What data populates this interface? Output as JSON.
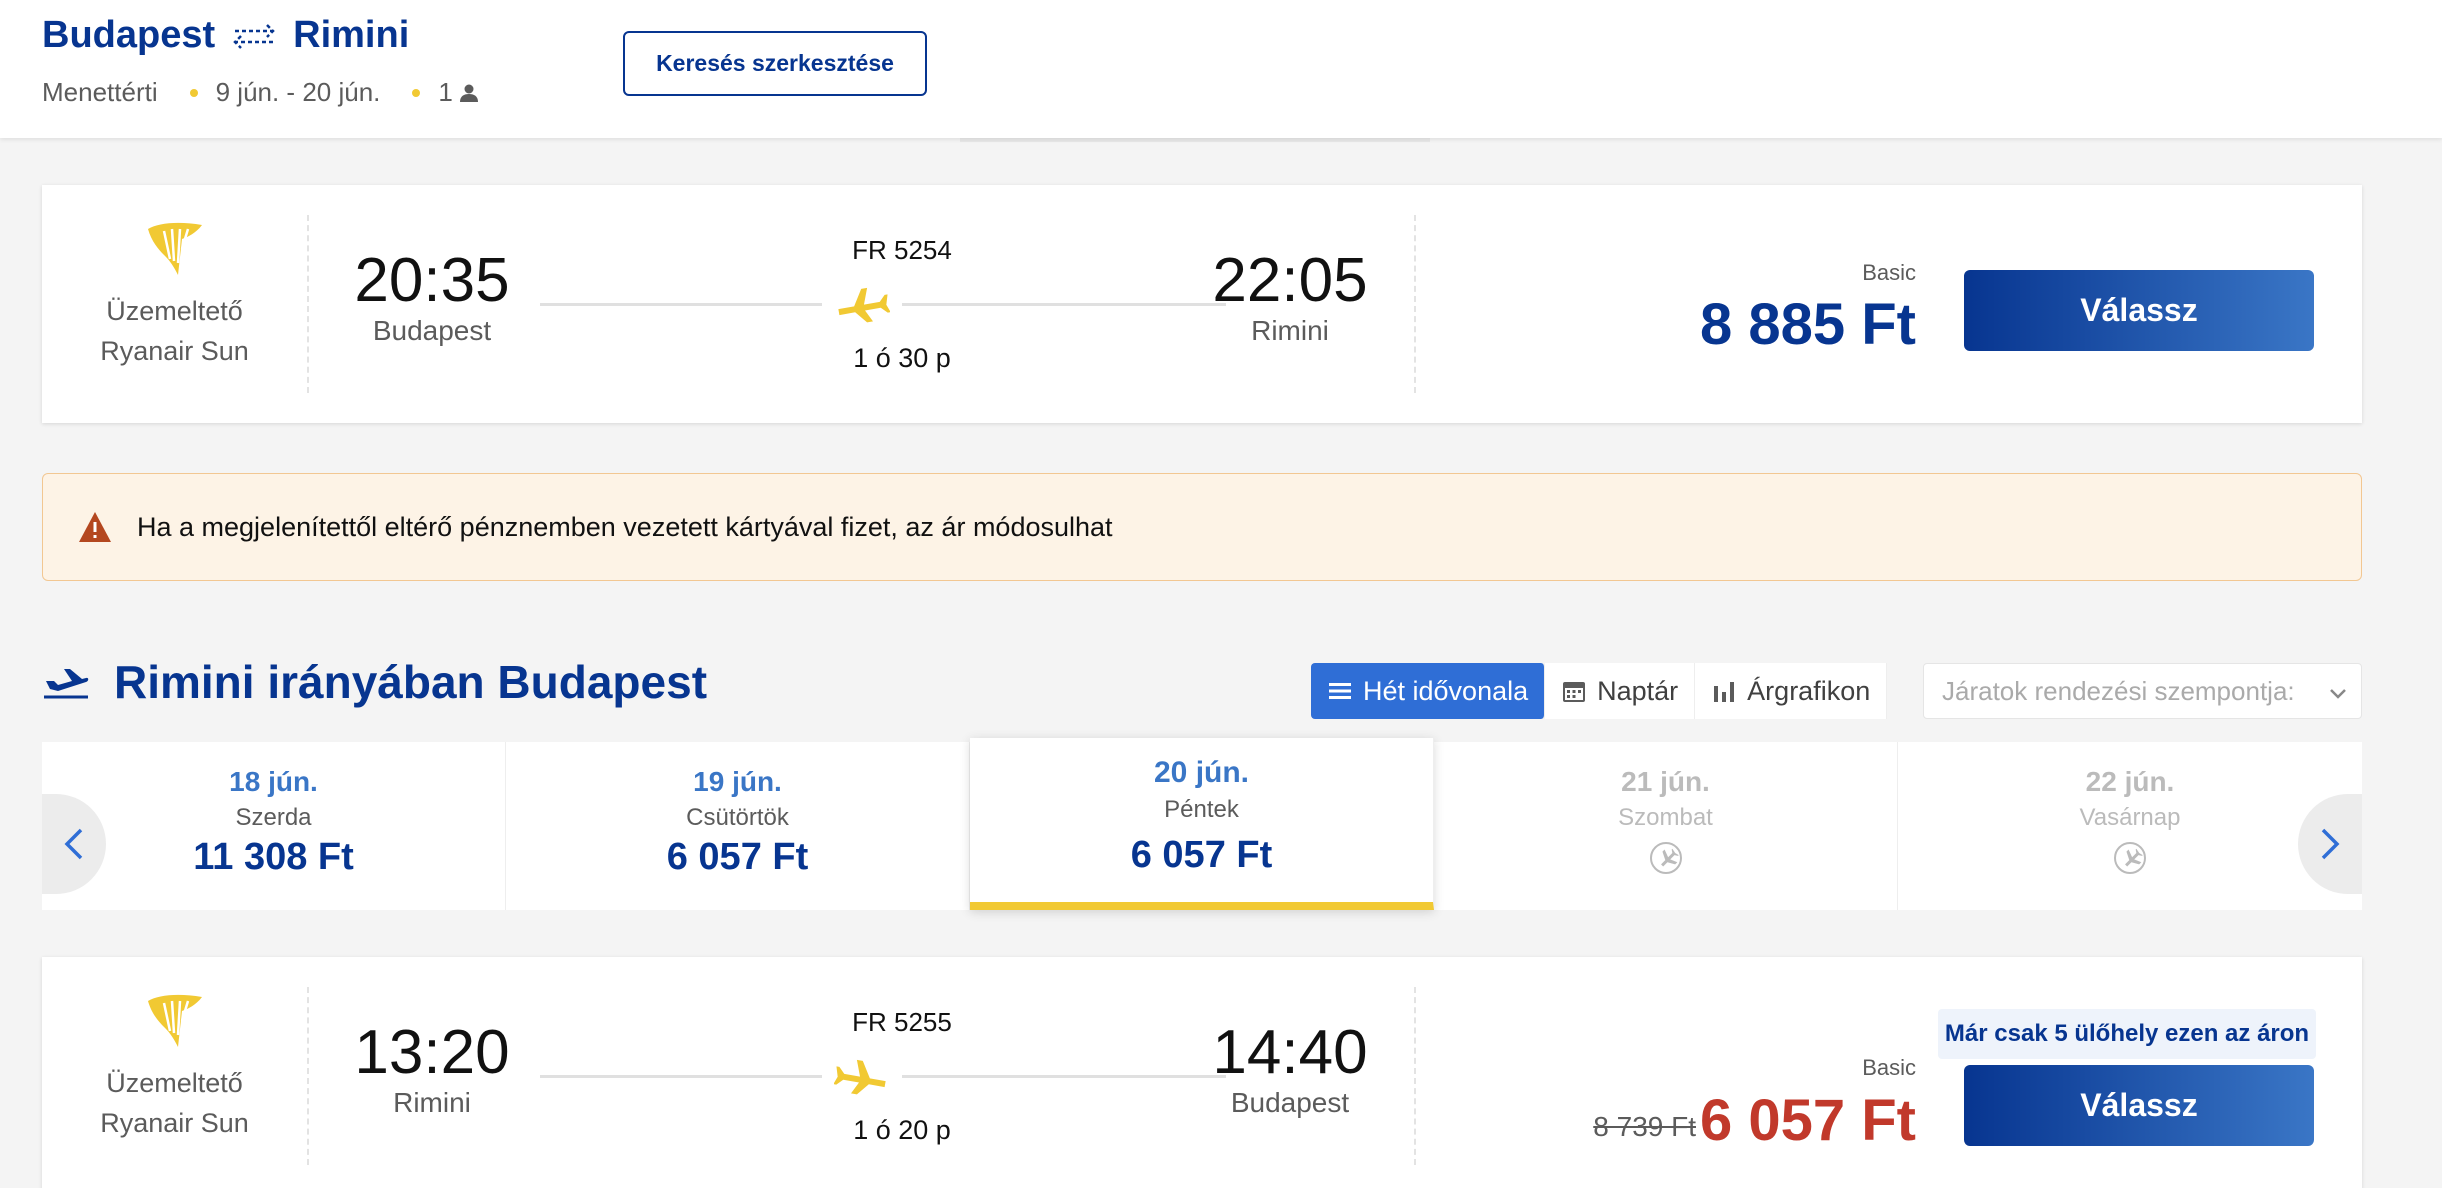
{
  "header": {
    "origin": "Budapest",
    "destination": "Rimini",
    "trip_type": "Menettérti",
    "dates": "9 jún. - 20 jún.",
    "passengers": "1",
    "edit_label": "Keresés szerkesztése"
  },
  "outbound_flight": {
    "operator_label": "Üzemeltető",
    "operator_name": "Ryanair Sun",
    "dep_time": "20:35",
    "dep_city": "Budapest",
    "flight_no": "FR 5254",
    "duration": "1 ó 30 p",
    "arr_time": "22:05",
    "arr_city": "Rimini",
    "fare_type": "Basic",
    "price": "8 885 Ft",
    "select_label": "Válassz"
  },
  "warning": {
    "text": "Ha a megjelenítettől eltérő pénznemben vezetett kártyával fizet, az ár módosulhat"
  },
  "return_section": {
    "title": "Rimini irányában Budapest",
    "tabs": [
      "Hét idővonala",
      "Naptár",
      "Árgrafikon"
    ],
    "sort_placeholder": "Járatok rendezési szempontja:"
  },
  "date_strip": [
    {
      "date": "18 jún.",
      "weekday": "Szerda",
      "price": "11 308 Ft"
    },
    {
      "date": "19 jún.",
      "weekday": "Csütörtök",
      "price": "6 057 Ft"
    },
    {
      "date": "20 jún.",
      "weekday": "Péntek",
      "price": "6 057 Ft"
    },
    {
      "date": "21 jún.",
      "weekday": "Szombat",
      "price": ""
    },
    {
      "date": "22 jún.",
      "weekday": "Vasárnap",
      "price": ""
    }
  ],
  "return_flight": {
    "operator_label": "Üzemeltető",
    "operator_name": "Ryanair Sun",
    "dep_time": "13:20",
    "dep_city": "Rimini",
    "flight_no": "FR 5255",
    "duration": "1 ó 20 p",
    "arr_time": "14:40",
    "arr_city": "Budapest",
    "fare_type": "Basic",
    "old_price": "8 739 Ft",
    "price": "6 057 Ft",
    "seats_badge": "Már csak 5 ülőhely ezen az áron",
    "select_label": "Válassz"
  },
  "colors": {
    "brand_blue": "#073590",
    "accent_blue": "#2f6ed6",
    "yellow": "#f1c933",
    "sale_red": "#c1392b"
  }
}
